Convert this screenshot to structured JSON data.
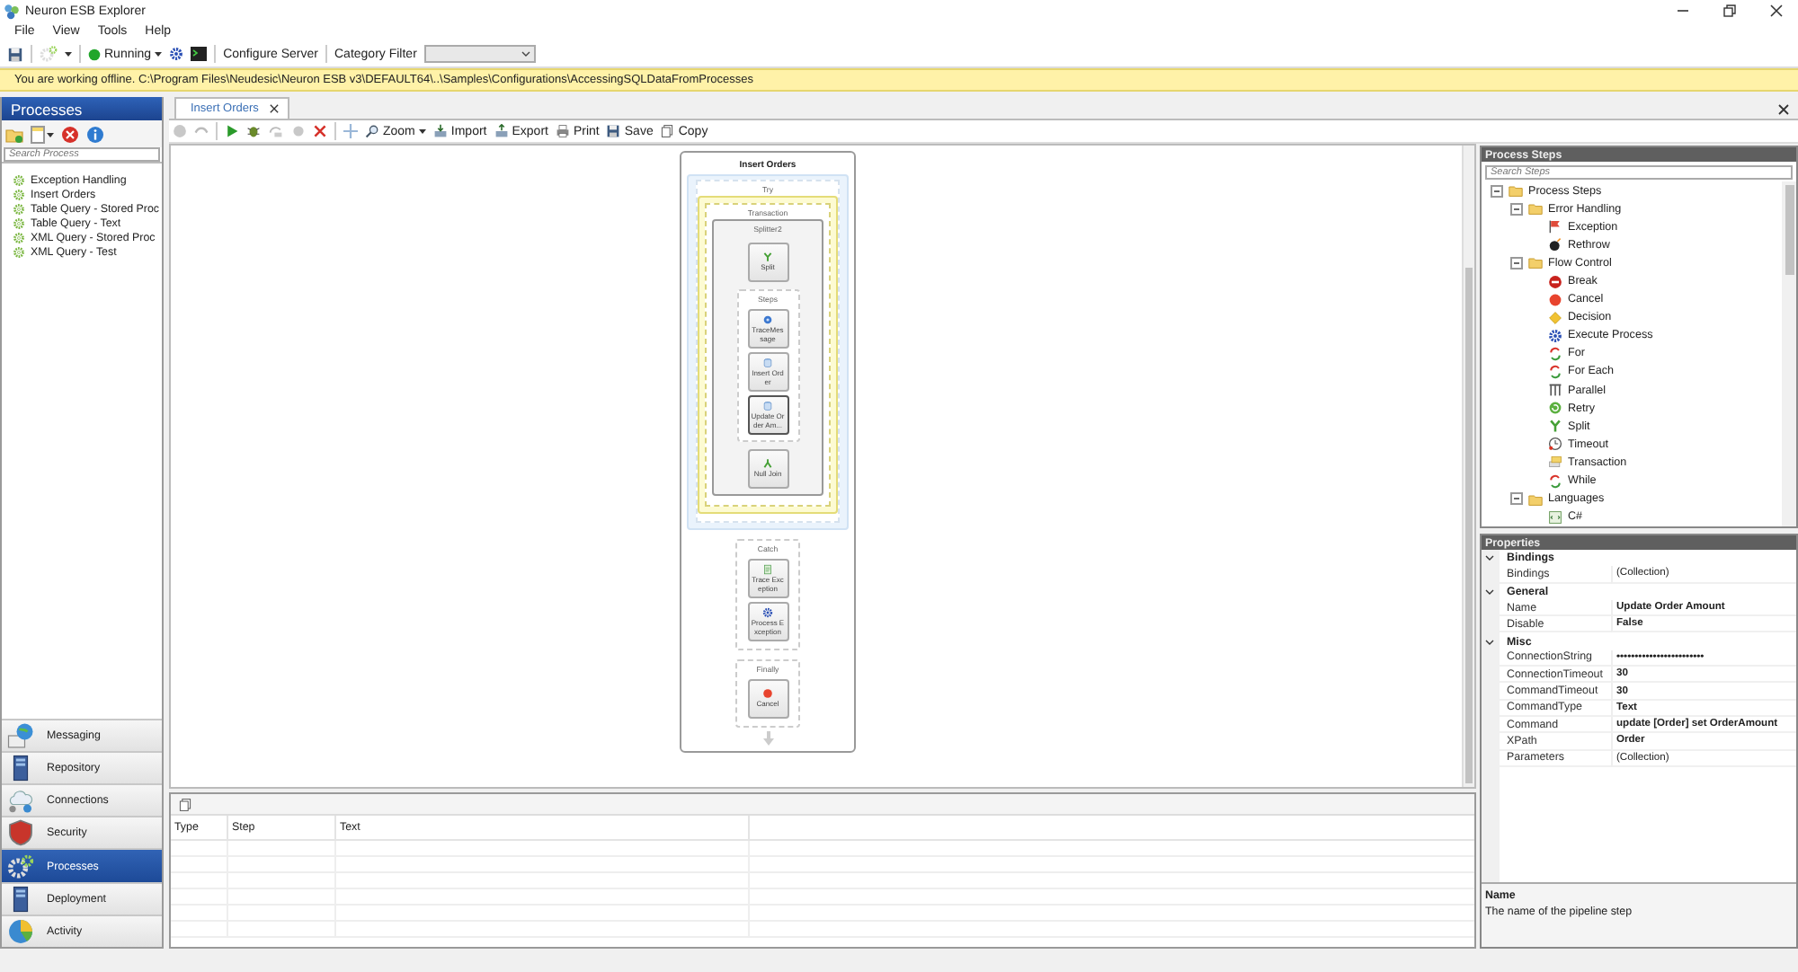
{
  "window": {
    "title": "Neuron ESB Explorer"
  },
  "menu": [
    "File",
    "View",
    "Tools",
    "Help"
  ],
  "toolbar": {
    "status": "Running",
    "configure": "Configure Server",
    "category_label": "Category Filter"
  },
  "info_bar": "You are working offline. C:\\Program Files\\Neudesic\\Neuron ESB v3\\DEFAULT64\\..\\Samples\\Configurations\\AccessingSQLDataFromProcesses",
  "left_panel": {
    "title": "Processes",
    "search_placeholder": "Search Process",
    "processes": [
      {
        "label": "Exception Handling",
        "selected": false
      },
      {
        "label": "Insert Orders",
        "selected": false
      },
      {
        "label": "Table Query - Stored Proc",
        "selected": false
      },
      {
        "label": "Table Query - Text",
        "selected": false
      },
      {
        "label": "XML Query - Stored Proc",
        "selected": false
      },
      {
        "label": "XML Query - Test",
        "selected": false
      }
    ],
    "nav": [
      {
        "label": "Messaging",
        "kind": "mail",
        "selected": false
      },
      {
        "label": "Repository",
        "kind": "server",
        "selected": false
      },
      {
        "label": "Connections",
        "kind": "cloud",
        "selected": false
      },
      {
        "label": "Security",
        "kind": "shield",
        "selected": false
      },
      {
        "label": "Processes",
        "kind": "gears",
        "selected": true
      },
      {
        "label": "Deployment",
        "kind": "server",
        "selected": false
      },
      {
        "label": "Activity",
        "kind": "pie",
        "selected": false
      }
    ]
  },
  "editor": {
    "tabs": [
      {
        "label": "Insert Orders",
        "selected": true
      }
    ],
    "toolbar": [
      {
        "label": "Zoom",
        "kind": "zoom"
      },
      {
        "label": "Import",
        "kind": "import"
      },
      {
        "label": "Export",
        "kind": "export"
      },
      {
        "label": "Print",
        "kind": "print"
      },
      {
        "label": "Save",
        "kind": "save"
      },
      {
        "label": "Copy",
        "kind": "copy"
      }
    ],
    "diagram": {
      "kind": "process",
      "label": "Insert Orders",
      "children": [
        {
          "kind": "try",
          "label": "Try",
          "children": [
            {
              "kind": "transaction",
              "label": "Transaction",
              "children": [
                {
                  "kind": "splitter",
                  "label": "Splitter2",
                  "children": [
                    {
                      "kind": "split",
                      "label": "Split",
                      "selected": false
                    },
                    {
                      "kind": "branch",
                      "label": "Steps",
                      "children": [
                        {
                          "kind": "trace",
                          "label": "TraceMessage",
                          "selected": false
                        },
                        {
                          "kind": "database",
                          "label": "Insert Order",
                          "selected": false
                        },
                        {
                          "kind": "database",
                          "label": "Update Order Am...",
                          "selected": true
                        }
                      ]
                    },
                    {
                      "kind": "join",
                      "label": "Null Join",
                      "selected": false
                    }
                  ]
                }
              ]
            }
          ]
        },
        {
          "kind": "block",
          "label": "Catch",
          "children": [
            {
              "kind": "document",
              "label": "Trace Exception",
              "selected": false
            },
            {
              "kind": "execute",
              "label": "Process Exception",
              "selected": false
            }
          ]
        },
        {
          "kind": "block",
          "label": "Finally",
          "children": [
            {
              "kind": "cancel",
              "label": "Cancel",
              "selected": false
            }
          ]
        }
      ]
    }
  },
  "messages": {
    "columns": [
      "Type",
      "Step",
      "Text"
    ]
  },
  "process_steps": {
    "title": "Process Steps",
    "search_placeholder": "Search Steps",
    "tree": [
      {
        "label": "Process Steps",
        "kind": "folder",
        "expanded": true,
        "children": [
          {
            "label": "Error Handling",
            "kind": "folder",
            "expanded": true,
            "children": [
              {
                "label": "Exception",
                "kind": "flag"
              },
              {
                "label": "Rethrow",
                "kind": "bomb"
              }
            ]
          },
          {
            "label": "Flow Control",
            "kind": "folder",
            "expanded": true,
            "children": [
              {
                "label": "Break",
                "kind": "noentry"
              },
              {
                "label": "Cancel",
                "kind": "cancel"
              },
              {
                "label": "Decision",
                "kind": "diamond"
              },
              {
                "label": "Execute Process",
                "kind": "execute"
              },
              {
                "label": "For",
                "kind": "loop"
              },
              {
                "label": "For Each",
                "kind": "loop"
              },
              {
                "label": "Parallel",
                "kind": "columns"
              },
              {
                "label": "Retry",
                "kind": "retry"
              },
              {
                "label": "Split",
                "kind": "split"
              },
              {
                "label": "Timeout",
                "kind": "clock"
              },
              {
                "label": "Transaction",
                "kind": "stack"
              },
              {
                "label": "While",
                "kind": "loop"
              }
            ]
          },
          {
            "label": "Languages",
            "kind": "folder",
            "expanded": true,
            "children": [
              {
                "label": "C#",
                "kind": "code"
              }
            ]
          }
        ]
      }
    ]
  },
  "properties": {
    "title": "Properties",
    "groups": [
      {
        "label": "Bindings",
        "expanded": true,
        "rows": [
          {
            "name": "Bindings",
            "value": "(Collection)",
            "bold": false
          }
        ]
      },
      {
        "label": "General",
        "expanded": true,
        "rows": [
          {
            "name": "Name",
            "value": "Update Order Amount",
            "bold": true
          },
          {
            "name": "Disable",
            "value": "False",
            "bold": true
          }
        ]
      },
      {
        "label": "Misc",
        "expanded": true,
        "rows": [
          {
            "name": "ConnectionString",
            "value": "••••••••••••••••••••••••",
            "bold": true
          },
          {
            "name": "ConnectionTimeout",
            "value": "30",
            "bold": true
          },
          {
            "name": "CommandTimeout",
            "value": "30",
            "bold": true
          },
          {
            "name": "CommandType",
            "value": "Text",
            "bold": true
          },
          {
            "name": "Command",
            "value": "update [Order] set OrderAmount",
            "bold": true
          },
          {
            "name": "XPath",
            "value": "Order",
            "bold": true
          },
          {
            "name": "Parameters",
            "value": "(Collection)",
            "bold": false
          }
        ]
      }
    ],
    "description": {
      "title": "Name",
      "text": "The name of the pipeline step"
    }
  }
}
